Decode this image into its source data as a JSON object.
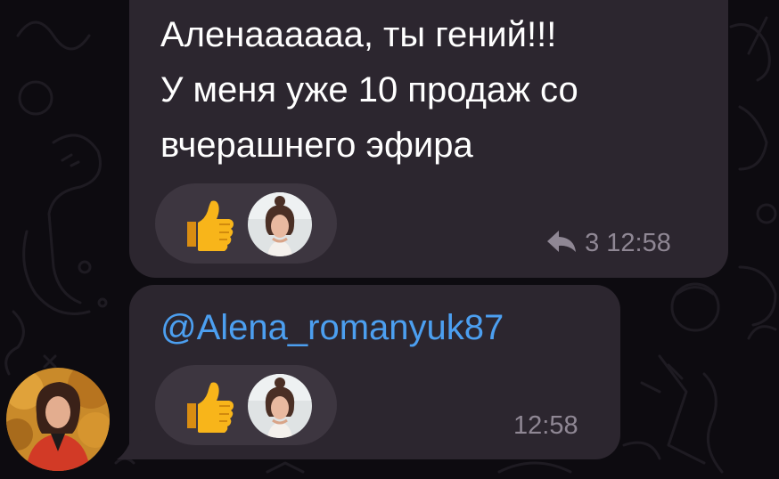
{
  "colors": {
    "background": "#0d0b10",
    "bubble": "#2c262f",
    "reaction_pill": "#3d3640",
    "text": "#ffffff",
    "mention": "#4c9ff0",
    "meta": "#8f8794"
  },
  "messages": [
    {
      "text": "Аленаааааа, ты гений!!!\nУ меня уже 10 продаж со\nвчерашнего эфира",
      "reaction": {
        "emoji": "thumbs-up-icon"
      },
      "reply_icon": "reply-icon",
      "reply_count": "3",
      "time": "12:58"
    },
    {
      "mention": "@Alena_romanyuk87",
      "reaction": {
        "emoji": "thumbs-up-icon"
      },
      "time": "12:58"
    }
  ]
}
